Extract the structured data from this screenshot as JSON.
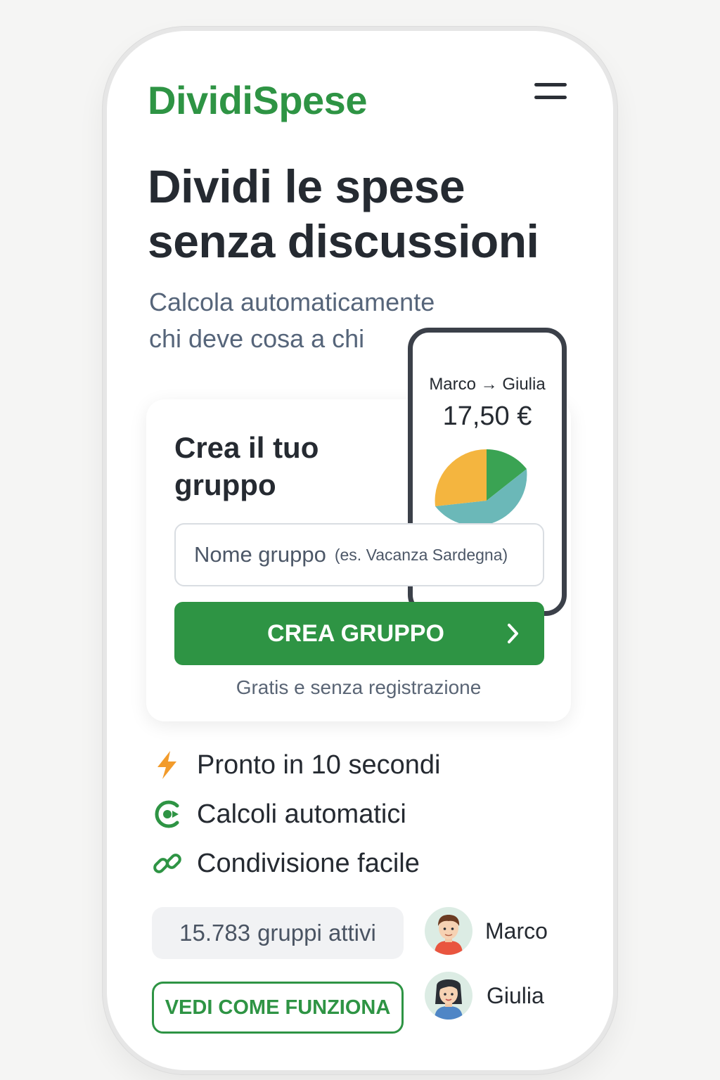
{
  "brand": {
    "name": "DividiSpese",
    "color": "#2e9444"
  },
  "header": {
    "menu_icon": "hamburger-menu-icon"
  },
  "hero": {
    "title_line1": "Dividi le spese",
    "title_line2": "senza discussioni",
    "subtitle_line1": "Calcola automaticamente",
    "subtitle_line2": "chi deve cosa a chi"
  },
  "preview": {
    "names": "Marco → Giulia",
    "amount": "17,50 €",
    "pie_colors": [
      "#f4b53f",
      "#3aa353",
      "#6bb8b8"
    ]
  },
  "create_card": {
    "title_line1": "Crea il tuo",
    "title_line2": "gruppo",
    "input_placeholder": "Nome gruppo",
    "input_hint": "(es. Vacanza Sardegna)",
    "cta_label": "CREA GRUPPO",
    "note": "Gratis e senza registrazione"
  },
  "features": [
    {
      "icon": "lightning-bolt-icon",
      "label": "Pronto in 10 secondi"
    },
    {
      "icon": "auto-calc-icon",
      "label": "Calcoli automatici"
    },
    {
      "icon": "link-icon",
      "label": "Condivisione facile"
    }
  ],
  "stats": {
    "count": "15.783",
    "label": "gruppi attivi"
  },
  "secondary_cta": {
    "label": "VEDI COME FUNZIONA"
  },
  "users": [
    {
      "name": "Marco",
      "icon": "avatar-male-icon"
    },
    {
      "name": "Giulia",
      "icon": "avatar-female-icon"
    }
  ]
}
